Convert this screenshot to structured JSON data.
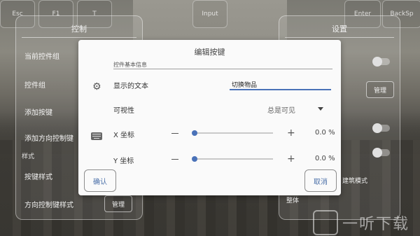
{
  "hud": {
    "keys": [
      "Esc",
      "F1",
      "T",
      "Input",
      "Enter",
      "BackSp"
    ]
  },
  "left_panel": {
    "title": "控制",
    "items": [
      "当前控件组",
      "控件组",
      "添加按键",
      "添加方向控制键"
    ],
    "section": "样式",
    "style_items": [
      "按键样式",
      "方向控制键样式"
    ],
    "manage_label": "管理"
  },
  "right_panel": {
    "title": "设置",
    "manage_label": "管理",
    "items": [
      "建筑模式",
      "整体"
    ]
  },
  "dialog": {
    "title": "编辑按键",
    "section_label": "控件基本信息",
    "display_text_label": "显示的文本",
    "display_text_value": "切换物品",
    "visibility_label": "可视性",
    "visibility_value": "总是可见",
    "x_label": "X 坐标",
    "x_value": "0.0 %",
    "x_position": 0.0,
    "y_label": "Y 坐标",
    "y_value": "0.0 %",
    "y_position": 0.0,
    "confirm_label": "确认",
    "cancel_label": "取消",
    "colors": {
      "accent": "#4a72b8",
      "button_text": "#4a6fa8"
    }
  },
  "watermark": "一听下载"
}
